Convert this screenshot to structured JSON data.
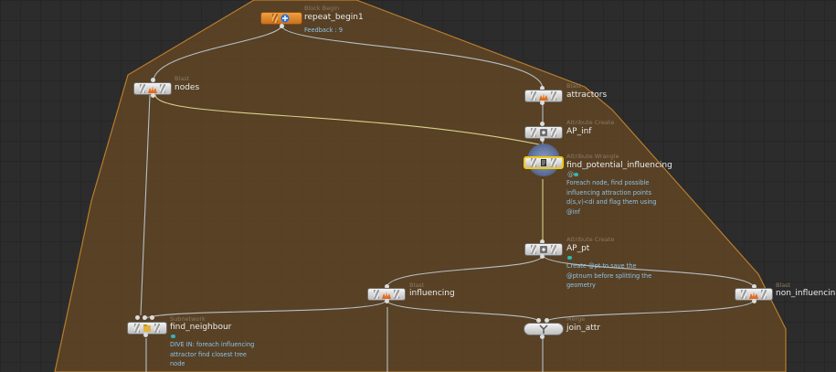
{
  "colors": {
    "block_fill": "#6a4a22",
    "block_edge": "#b97d2c",
    "wire": "#b7bfc6",
    "wire_highlight": "#d8d28a",
    "comment_text": "#8fc3e6",
    "type_text": "#8a7a66",
    "name_text": "#ececec",
    "flag": "#2fb7b1"
  },
  "nodes": {
    "repeat_begin": {
      "type": "Block Begin",
      "name": "repeat_begin1",
      "comment": "Feedback : 9",
      "icon": "block-begin-icon"
    },
    "nodes_blast": {
      "type": "Blast",
      "name": "nodes",
      "icon": "blast-icon"
    },
    "attractors_blast": {
      "type": "Blast",
      "name": "attractors",
      "icon": "blast-icon"
    },
    "ap_inf": {
      "type": "Attribute Create",
      "name": "AP_inf",
      "icon": "attribute-create-icon"
    },
    "find_potential": {
      "type": "Attribute Wrangle",
      "name": "find_potential_influencing",
      "badge": "@",
      "comment": "Foreach node, find possible\ninfluencing attraction points\nd(s,v)<di and flag them using\n@inf",
      "icon": "attribute-wrangle-icon"
    },
    "ap_pt": {
      "type": "Attribute Create",
      "name": "AP_pt",
      "comment": "Create @pt to save the\n@ptnum before splitting the\ngeometry",
      "icon": "attribute-create-icon"
    },
    "influencing": {
      "type": "Blast",
      "name": "influencing",
      "icon": "blast-icon"
    },
    "non_influencing": {
      "type": "Blast",
      "name": "non_influencing",
      "icon": "blast-icon"
    },
    "find_neighbour": {
      "type": "Subnetwork",
      "name": "find_neighbour",
      "comment": "DIVE IN: foreach influencing\nattractor find closest tree\nnode",
      "icon": "subnetwork-icon"
    },
    "join_attr": {
      "type": "Merge",
      "name": "join_attr",
      "icon": "merge-icon"
    }
  }
}
